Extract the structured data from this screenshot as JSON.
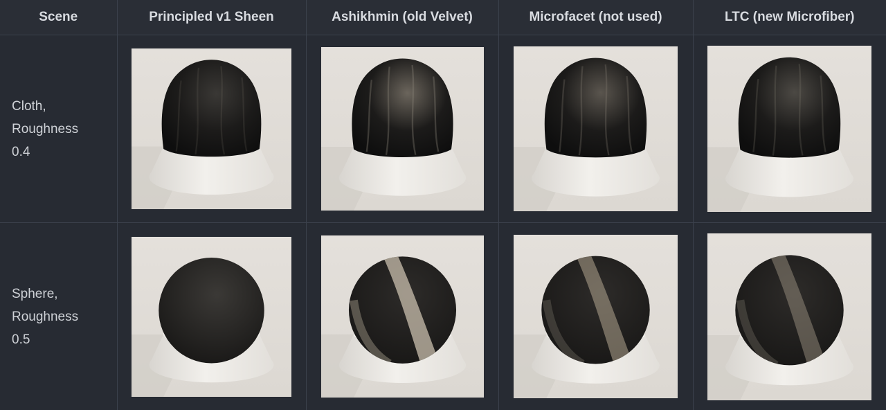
{
  "table": {
    "headers": [
      "Scene",
      "Principled v1 Sheen",
      "Ashikhmin (old Velvet)",
      "Microfacet (not used)",
      "LTC (new Microfiber)"
    ],
    "rows": [
      {
        "label_lines": [
          "Cloth,",
          "Roughness",
          "0.4"
        ],
        "renders": [
          {
            "icon": "cloth-render-image"
          },
          {
            "icon": "cloth-render-image"
          },
          {
            "icon": "cloth-render-image"
          },
          {
            "icon": "cloth-render-image"
          }
        ]
      },
      {
        "label_lines": [
          "Sphere,",
          "Roughness",
          "0.5"
        ],
        "renders": [
          {
            "icon": "sphere-render-image"
          },
          {
            "icon": "sphere-render-image"
          },
          {
            "icon": "sphere-render-image"
          },
          {
            "icon": "sphere-render-image"
          }
        ]
      }
    ]
  },
  "colors": {
    "page_background": "#272b33",
    "grid_border": "#3b414c",
    "text": "#d4d7dc",
    "render_backdrop": "#e2ded9",
    "pedestal": "#ebe8e4"
  }
}
